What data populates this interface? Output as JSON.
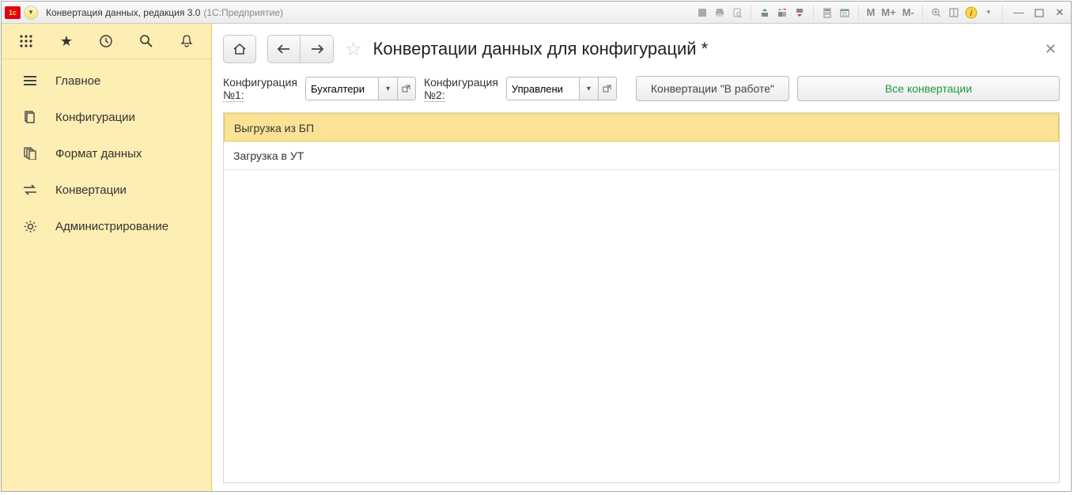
{
  "window": {
    "title": "Конвертация данных, редакция 3.0",
    "subtitle": "(1С:Предприятие)"
  },
  "toolbar_icons": {
    "m": "М",
    "mplus": "М+",
    "mminus": "М-"
  },
  "sidebar": {
    "items": [
      {
        "label": "Главное"
      },
      {
        "label": "Конфигурации"
      },
      {
        "label": "Формат данных"
      },
      {
        "label": "Конвертации"
      },
      {
        "label": "Администрирование"
      }
    ]
  },
  "page": {
    "title": "Конвертации данных для конфигураций *"
  },
  "filters": {
    "label1_line1": "Конфигурация",
    "label1_line2": "№1:",
    "value1": "Бухгалтери",
    "label2_line1": "Конфигурация",
    "label2_line2": "№2:",
    "value2": "Управлени",
    "btn_inwork": "Конвертации \"В работе\"",
    "btn_all": "Все конвертации"
  },
  "rows": [
    {
      "label": "Выгрузка из БП"
    },
    {
      "label": "Загрузка в УТ"
    }
  ]
}
